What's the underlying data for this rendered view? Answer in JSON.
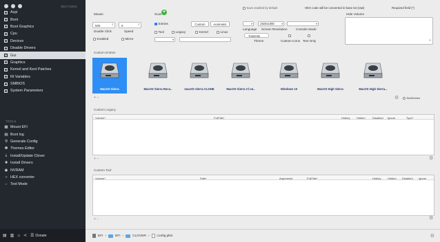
{
  "sidebar": {
    "sections_label": "SECTIONS",
    "tools_label": "TOOLS",
    "sections": [
      "Acpi",
      "Boot",
      "Boot Graphics",
      "Cpu",
      "Devices",
      "Disable Drivers",
      "Gui",
      "Graphics",
      "Kernel and Kext Patches",
      "Rt Variables",
      "SMBIOS",
      "System Parameters"
    ],
    "active_index": 6,
    "tools": [
      {
        "icon": "mount-icon",
        "label": "Mount EFI"
      },
      {
        "icon": "bootlog-icon",
        "label": "Boot log"
      },
      {
        "icon": "search-icon",
        "label": "Generate Config"
      },
      {
        "icon": "theme-icon",
        "label": "Themes Editor"
      },
      {
        "icon": "download-icon",
        "label": "Install/Update Clover"
      },
      {
        "icon": "install-icon",
        "label": "Install Drivers"
      },
      {
        "icon": "nvram-icon",
        "label": "NVRAM"
      },
      {
        "icon": "hex-icon",
        "label": "HEX converter"
      },
      {
        "icon": "textmode-icon",
        "label": "Text Mode"
      }
    ],
    "bottom": {
      "donate_label": "Donate"
    }
  },
  "top_right": {
    "label1": "Save enabled by default",
    "label2": "HEX code will be converted in base 64 (raw)",
    "label3": "Required field (*)"
  },
  "mouse": {
    "title": "Mouse",
    "dclick_value": "500",
    "speed_value": "8",
    "dclick_label": "Double Click",
    "speed_label": "Speed",
    "enabled_label": "Enabled",
    "mirror_label": "Mirror"
  },
  "scan": {
    "title": "Scan",
    "entries_label": "Entries",
    "custom_btn": "Custom",
    "auto_btn": "Automatic",
    "tool_label": "Tool",
    "legacy_label": "Legacy",
    "kernel_label": "Kernel",
    "linux_label": "Linux"
  },
  "language": {
    "lang_select": "",
    "resolution_select": "1920x1080",
    "console_select": "",
    "language_label": "Language",
    "resolution_label": "Screen Resolution",
    "console_label": "Console Mode",
    "theme_value": "Yosemite",
    "theme_label": "Theme",
    "custom_icons_label": "Custom Icons",
    "textonly_label": "Text Only"
  },
  "hide_volume": {
    "title": "Hide Volume"
  },
  "custom_entries": {
    "title": "Custom Entries",
    "items": [
      "MacOS Sierra",
      "MacOS Sierra Reco..",
      "macOS Sierra CLONE",
      "MacOS Sierra Cl on..",
      "Windows 10",
      "MacOS High Sierra",
      "MacOS High Sierra..."
    ],
    "selected_index": 0,
    "subentries_label": "SubEntries"
  },
  "custom_legacy": {
    "title": "Custom Legacy",
    "columns": [
      "Volume*",
      "FullTitle*",
      "Hotkey",
      "Hidden",
      "Disabled",
      "Ignore",
      "Type*"
    ]
  },
  "custom_tool": {
    "title": "Custom Tool",
    "columns": [
      "Volume*",
      "Path*",
      "Arguments",
      "FullTitle*",
      "Hotkey",
      "Hidden",
      "Disabled",
      "Ignore"
    ]
  },
  "breadcrumb": {
    "items": [
      "EFI",
      "EFI",
      "CLOVER",
      "config.plist"
    ]
  }
}
